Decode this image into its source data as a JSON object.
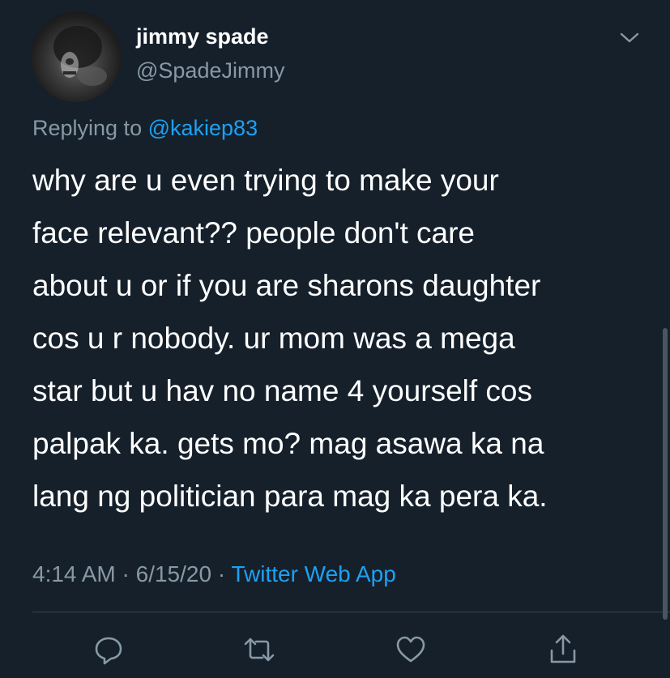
{
  "author": {
    "display_name": "jimmy spade",
    "handle": "@SpadeJimmy"
  },
  "reply": {
    "prefix": "Replying to ",
    "mention": "@kakiep83"
  },
  "tweet": {
    "lines": [
      "why are u even trying to make your",
      "face relevant?? people don't care",
      "about u or if you are sharons daughter",
      "cos u r nobody. ur mom was a mega",
      "star but u hav no name 4 yourself cos",
      "palpak ka. gets mo?  mag asawa ka na",
      "lang ng politician para mag ka pera ka."
    ]
  },
  "meta": {
    "time": "4:14 AM",
    "separator": " · ",
    "date": "6/15/20",
    "source": "Twitter Web App"
  },
  "actions": {
    "icons": [
      "reply-icon",
      "retweet-icon",
      "like-icon",
      "share-icon"
    ]
  },
  "colors": {
    "background": "#15202b",
    "text": "#ffffff",
    "secondary": "#8899a6",
    "accent": "#1da1f2",
    "divider": "#38444d"
  }
}
